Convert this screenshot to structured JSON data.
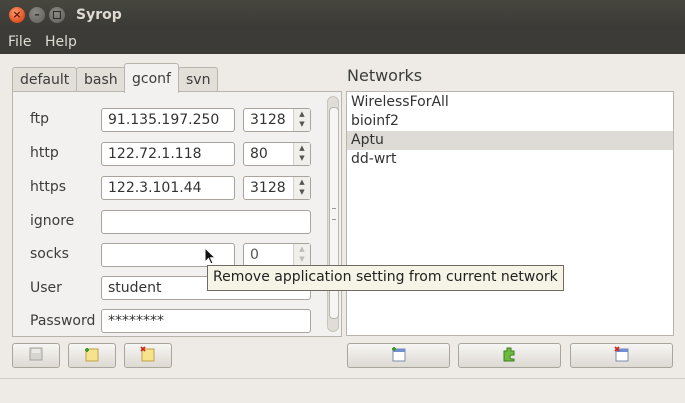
{
  "window": {
    "title": "Syrop"
  },
  "menu": {
    "file": "File",
    "help": "Help"
  },
  "tabs": [
    {
      "label": "default"
    },
    {
      "label": "bash"
    },
    {
      "label": "gconf"
    },
    {
      "label": "svn"
    }
  ],
  "active_tab": "gconf",
  "fields": {
    "ftp": {
      "label": "ftp",
      "host": "91.135.197.250",
      "port": "3128"
    },
    "http": {
      "label": "http",
      "host": "122.72.1.118",
      "port": "80"
    },
    "https": {
      "label": "https",
      "host": "122.3.101.44",
      "port": "3128"
    },
    "ignore": {
      "label": "ignore",
      "value": ""
    },
    "socks": {
      "label": "socks",
      "host": "",
      "port": "0"
    },
    "user": {
      "label": "User",
      "value": "student"
    },
    "password": {
      "label": "Password",
      "value": "********"
    }
  },
  "networks": {
    "title": "Networks",
    "items": [
      "WirelessForAll",
      "bioinf2",
      "Aptu",
      "dd-wrt"
    ],
    "selected": "Aptu"
  },
  "tooltip": "Remove application setting from current network",
  "icons": {
    "save": "save-icon",
    "add_setting": "add-setting-icon",
    "remove_setting": "remove-setting-icon",
    "new_network": "new-network-icon",
    "plugin": "plugin-icon",
    "remove_network": "remove-network-icon"
  },
  "colors": {
    "titlebar": "#3c3b37",
    "close_button": "#e4582a",
    "selection": "#dedbd6",
    "tooltip_bg": "#f5f4e6"
  }
}
